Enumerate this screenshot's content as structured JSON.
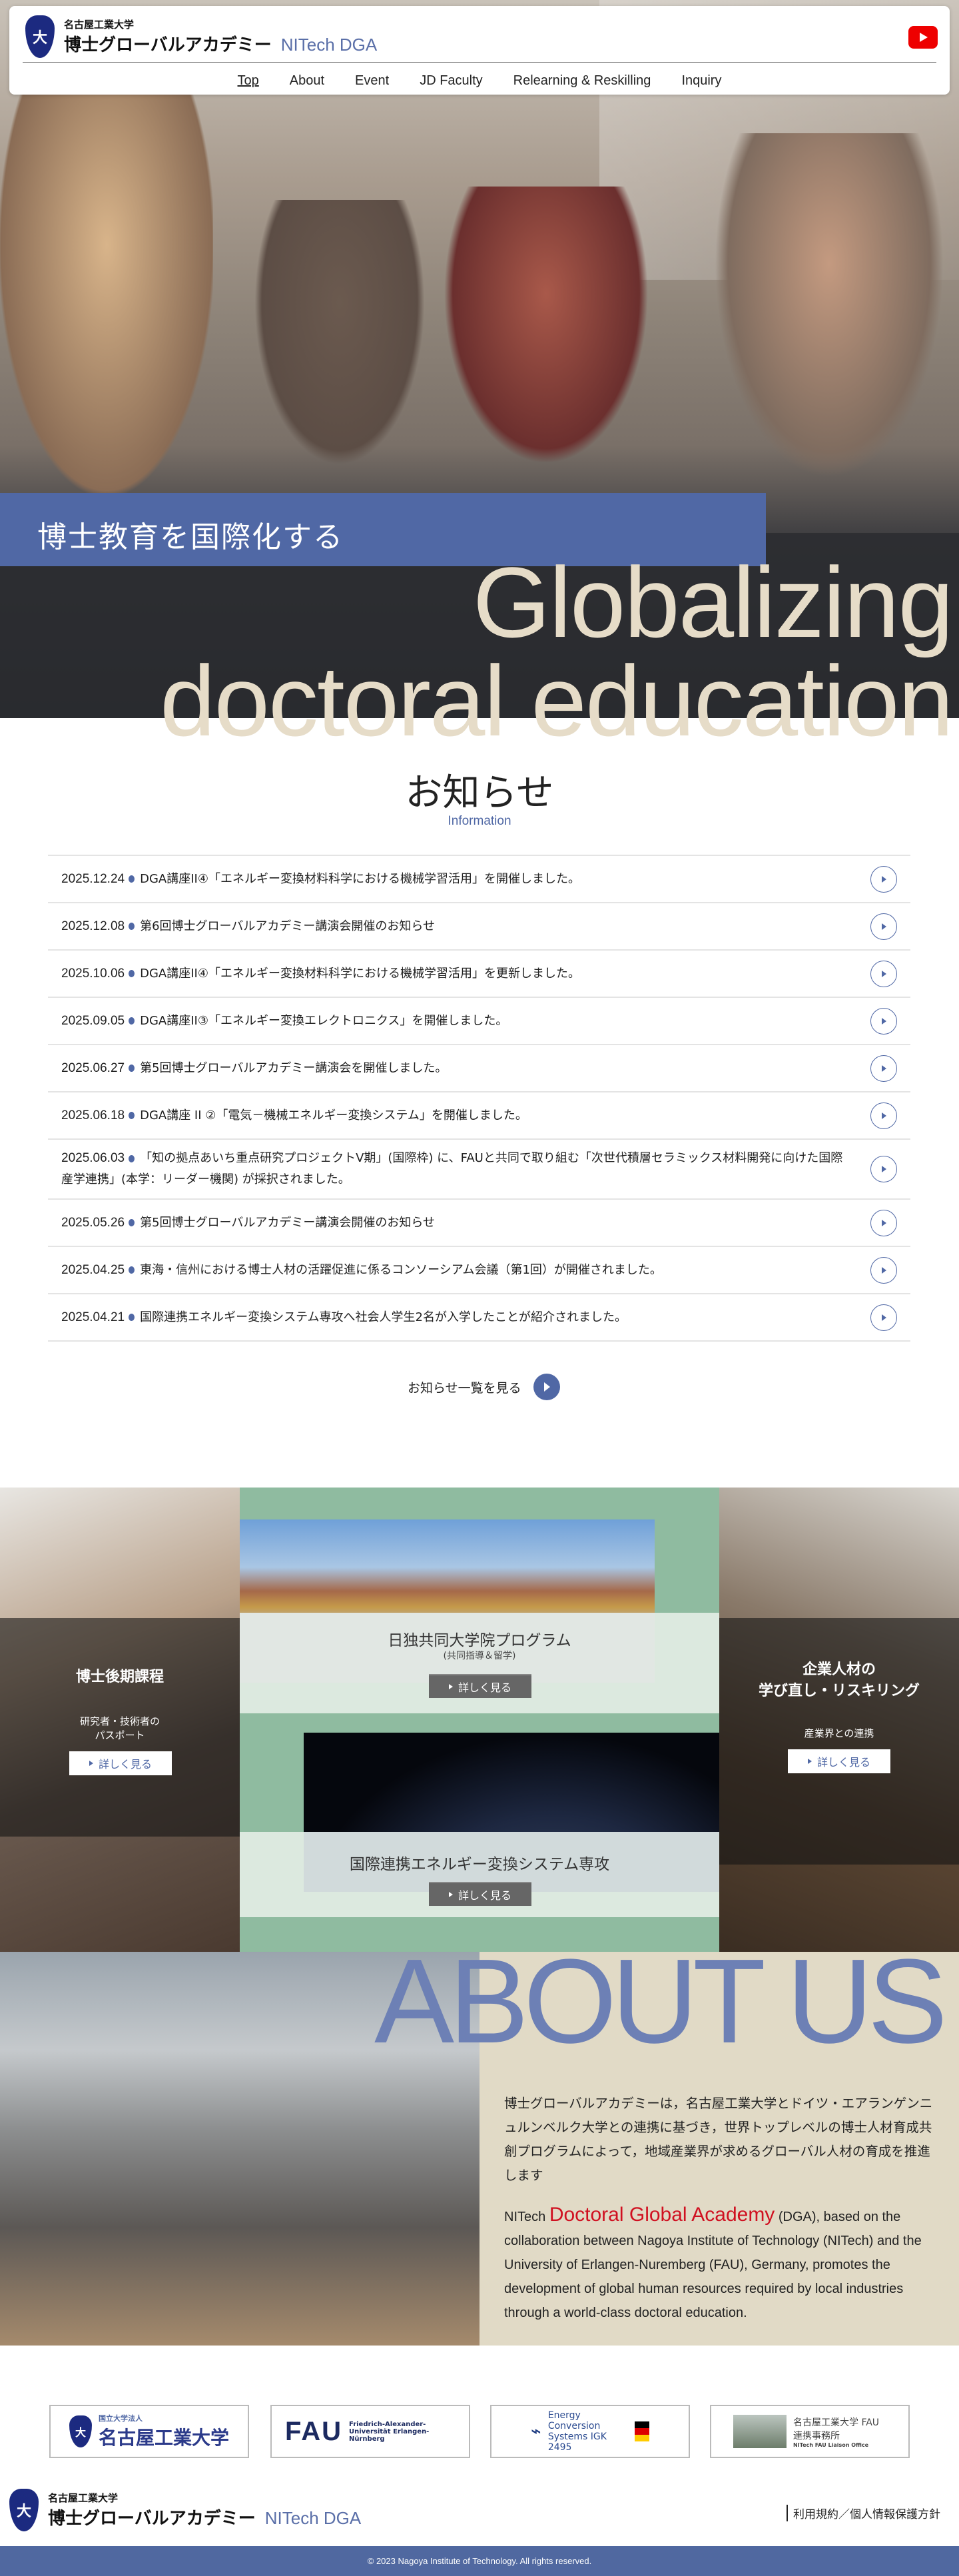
{
  "header": {
    "university": "名古屋工業大学",
    "academy": "博士グローバルアカデミー",
    "academy_en": "NITech DGA",
    "logo_glyph": "大",
    "youtube_icon": "youtube-icon"
  },
  "nav": [
    "Top",
    "About",
    "Event",
    "JD Faculty",
    "Relearning & Reskilling",
    "Inquiry"
  ],
  "hero": {
    "banner": "博士教育を国際化する",
    "slogan_line1": "Globalizing",
    "slogan_line2": "doctoral education"
  },
  "news": {
    "title": "お知らせ",
    "subtitle": "Information",
    "items": [
      {
        "date": "2025.12.24",
        "text": "DGA講座II④「エネルギー変換材料科学における機械学習活用」を開催しました。"
      },
      {
        "date": "2025.12.08",
        "text": "第6回博士グローバルアカデミー講演会開催のお知らせ"
      },
      {
        "date": "2025.10.06",
        "text": "DGA講座II④「エネルギー変換材料科学における機械学習活用」を更新しました。"
      },
      {
        "date": "2025.09.05",
        "text": "DGA講座II③「エネルギー変換エレクトロニクス」を開催しました。"
      },
      {
        "date": "2025.06.27",
        "text": "第5回博士グローバルアカデミー講演会を開催しました。"
      },
      {
        "date": "2025.06.18",
        "text": "DGA講座 II ②「電気－機械エネルギー変換システム」を開催しました。"
      },
      {
        "date": "2025.06.03",
        "text": "「知の拠点あいち重点研究プロジェクトV期」(国際枠) に、FAUと共同で取り組む「次世代積層セラミックス材料開発に向けた国際産学連携」(本学：リーダー機関) が採択されました。"
      },
      {
        "date": "2025.05.26",
        "text": "第5回博士グローバルアカデミー講演会開催のお知らせ"
      },
      {
        "date": "2025.04.25",
        "text": "東海・信州における博士人材の活躍促進に係るコンソーシアム会議（第1回）が開催されました。"
      },
      {
        "date": "2025.04.21",
        "text": "国際連携エネルギー変換システム専攻へ社会人学生2名が入学したことが紹介されました。"
      }
    ],
    "more_label": "お知らせ一覧を見る"
  },
  "cards": {
    "doctoral": {
      "title": "博士後期課程",
      "sub1": "研究者・技術者の",
      "sub2": "パスポート",
      "button": "詳しく見る"
    },
    "joint": {
      "title": "日独共同大学院プログラム",
      "sub": "(共同指導＆留学)",
      "button": "詳しく見る"
    },
    "energy": {
      "title": "国際連携エネルギー変換システム専攻",
      "button": "詳しく見る"
    },
    "reskill": {
      "title1": "企業人材の",
      "title2": "学び直し・リスキリング",
      "sub": "産業界との連携",
      "button": "詳しく見る"
    }
  },
  "about": {
    "heading": "ABOUT US",
    "jp": "博士グローバルアカデミーは，名古屋工業大学とドイツ・エアランゲンニュルンベルク大学との連携に基づき，世界トップレベルの博士人材育成共創プログラムによって，地域産業界が求めるグローバル人材の育成を推進します",
    "en_prefix": "NITech ",
    "en_highlight": "Doctoral Global Academy",
    "en_rest": " (DGA), based on the collaboration between Nagoya Institute of Technology (NITech) and the University of Erlangen-Nuremberg (FAU), Germany, promotes the development of global human resources required by local industries through a world-class doctoral education."
  },
  "partners": [
    {
      "small": "国立大学法人",
      "name": "名古屋工業大学"
    },
    {
      "name": "FAU",
      "small": "Friedrich-Alexander-Universität Erlangen-Nürnberg"
    },
    {
      "name": "Energy Conversion Systems IGK 2495"
    },
    {
      "name": "名古屋工業大学 FAU連携事務所",
      "small": "NITech FAU Liaison Office"
    }
  ],
  "footer": {
    "link": "利用規約／個人情報保護方針",
    "copyright": "© 2023 Nagoya Institute of Technology. All rights reserved."
  },
  "colors": {
    "accent": "#5068a5",
    "green": "#8fbba0",
    "beige": "#e1dac6",
    "about_heading": "#6d80b5"
  }
}
